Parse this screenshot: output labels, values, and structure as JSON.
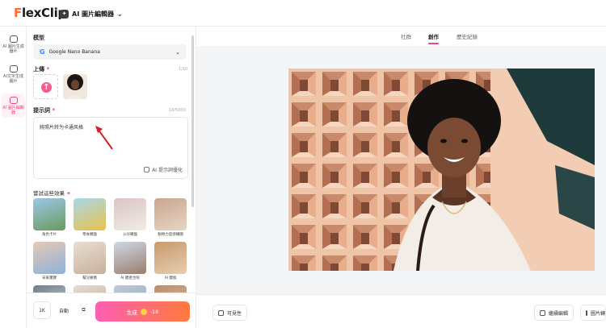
{
  "header": {
    "logo_first": "F",
    "logo_rest": "lexClip",
    "app_switch_label": "AI 圖片編輯器",
    "app_switch_chevron": "⌄"
  },
  "rail": {
    "items": [
      {
        "label": "AI 圖片生成器片",
        "icon": "image-generate-icon",
        "active": false
      },
      {
        "label": "AI文字生成圖片",
        "icon": "text-to-image-icon",
        "active": false
      },
      {
        "label": "AI 圖片編輯器",
        "icon": "image-edit-icon",
        "active": true
      }
    ]
  },
  "panel": {
    "model_label": "模型",
    "model_value": "Google Nano Banana",
    "model_logo": "G",
    "upload_label": "上傳",
    "upload_required": "*",
    "upload_count": "1/10",
    "prompt_label": "提示詞",
    "prompt_required": "*",
    "prompt_count": "18/5000",
    "prompt_text": "將照片转为卡通风格",
    "prompt_optimize": "AI 提示詞優化",
    "try_label": "嘗試這些效果",
    "tiles": [
      {
        "caption": "角色卡片",
        "colors": [
          "#9cc7e8",
          "#6b9a5c"
        ]
      },
      {
        "caption": "零食櫃盤",
        "colors": [
          "#a9d8ea",
          "#e9c24a"
        ]
      },
      {
        "caption": "公仔櫃盤",
        "colors": [
          "#d8c5c2",
          "#f2ece6"
        ]
      },
      {
        "caption": "動物力度感櫃圖",
        "colors": [
          "#c9a58f",
          "#e7d6c4"
        ]
      },
      {
        "caption": "未來寶寶",
        "colors": [
          "#e6c8b8",
          "#8db2d8"
        ]
      },
      {
        "caption": "幫兒療癒",
        "colors": [
          "#e9ddd3",
          "#c8b09b"
        ]
      },
      {
        "caption": "AI 聽者合照",
        "colors": [
          "#cfd9e6",
          "#9a7d6b"
        ]
      },
      {
        "caption": "AI 變換",
        "colors": [
          "#c79a6b",
          "#e7cdb0"
        ]
      },
      {
        "caption": "",
        "colors": [
          "#6f7d89",
          "#d6dde4"
        ]
      },
      {
        "caption": "",
        "colors": [
          "#e6dcd2",
          "#b8a896"
        ]
      },
      {
        "caption": "",
        "colors": [
          "#c0cbd6",
          "#8aa0b5"
        ]
      },
      {
        "caption": "",
        "colors": [
          "#b98e6e",
          "#d9c0a8"
        ]
      }
    ],
    "resolution": "1K",
    "aspect": "自動",
    "generate_label": "生成",
    "generate_cost": "-18"
  },
  "main": {
    "tabs": [
      {
        "label": "社群",
        "active": false
      },
      {
        "label": "創作",
        "active": true
      },
      {
        "label": "歷史紀錄",
        "active": false
      }
    ],
    "visibility_label": "可見性",
    "edit_label": "繼續編輯",
    "image_label": "圖片轉"
  },
  "colors": {
    "accent": "#f0447e",
    "generate_start": "#ff5fb4",
    "generate_end": "#ff7a3d",
    "wall": "#e9b392",
    "dark_bg": "#1f3a3a"
  }
}
